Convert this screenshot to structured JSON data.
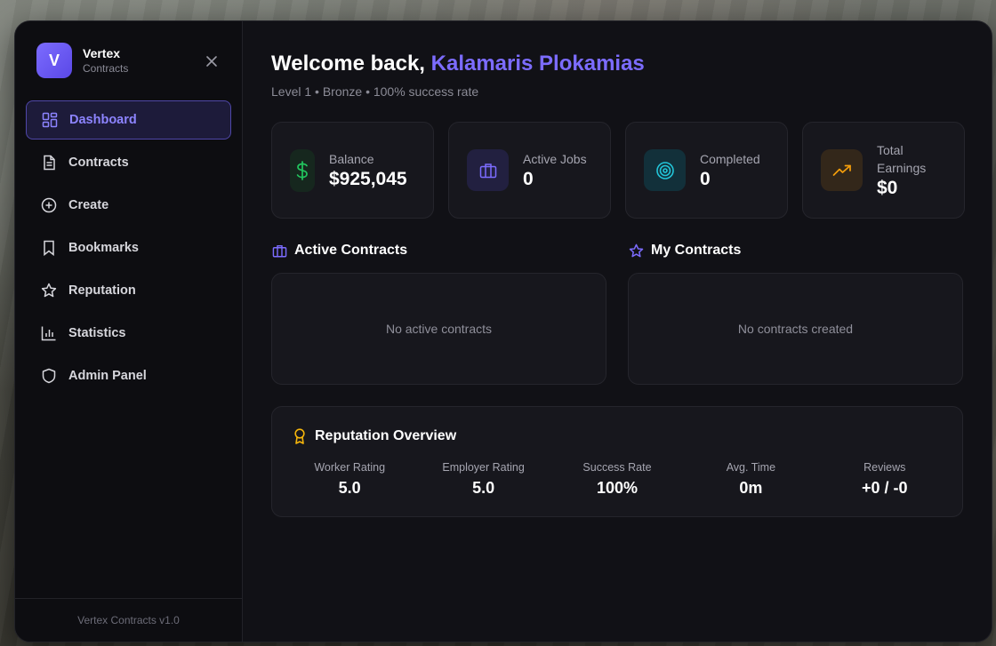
{
  "brand": {
    "logo_letter": "V",
    "name": "Vertex",
    "subtitle": "Contracts"
  },
  "sidebar": {
    "items": [
      {
        "label": "Dashboard",
        "icon": "dashboard-icon",
        "active": true
      },
      {
        "label": "Contracts",
        "icon": "document-icon"
      },
      {
        "label": "Create",
        "icon": "plus-circle-icon"
      },
      {
        "label": "Bookmarks",
        "icon": "bookmark-icon"
      },
      {
        "label": "Reputation",
        "icon": "star-icon"
      },
      {
        "label": "Statistics",
        "icon": "bar-chart-icon"
      },
      {
        "label": "Admin Panel",
        "icon": "shield-icon"
      }
    ],
    "footer": "Vertex Contracts v1.0"
  },
  "header": {
    "greeting": "Welcome back,",
    "user_name": "Kalamaris Plokamias",
    "subline": "Level 1 • Bronze • 100% success rate"
  },
  "stats": [
    {
      "label": "Balance",
      "value": "$925,045",
      "icon": "dollar-icon",
      "color": "#22c55e"
    },
    {
      "label": "Active Jobs",
      "value": "0",
      "icon": "briefcase-icon",
      "color": "#7c6cff"
    },
    {
      "label": "Completed",
      "value": "0",
      "icon": "target-icon",
      "color": "#22c4d8"
    },
    {
      "label": "Total Earnings",
      "value": "$0",
      "icon": "trending-up-icon",
      "color": "#f59e0b"
    }
  ],
  "active_contracts": {
    "title": "Active Contracts",
    "empty_text": "No active contracts"
  },
  "my_contracts": {
    "title": "My Contracts",
    "empty_text": "No contracts created"
  },
  "reputation": {
    "title": "Reputation Overview",
    "metrics": [
      {
        "label": "Worker Rating",
        "value": "5.0"
      },
      {
        "label": "Employer Rating",
        "value": "5.0"
      },
      {
        "label": "Success Rate",
        "value": "100%"
      },
      {
        "label": "Avg. Time",
        "value": "0m"
      },
      {
        "label": "Reviews",
        "value": "+0 / -0"
      }
    ]
  },
  "colors": {
    "accent": "#7c6cff",
    "panel": "#17171d",
    "background": "#111116"
  }
}
